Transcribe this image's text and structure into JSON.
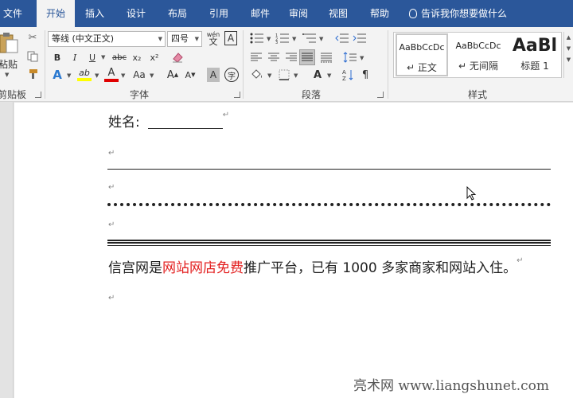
{
  "tabs": [
    {
      "label": "文件",
      "active": false
    },
    {
      "label": "开始",
      "active": true
    },
    {
      "label": "插入",
      "active": false
    },
    {
      "label": "设计",
      "active": false
    },
    {
      "label": "布局",
      "active": false
    },
    {
      "label": "引用",
      "active": false
    },
    {
      "label": "邮件",
      "active": false
    },
    {
      "label": "审阅",
      "active": false
    },
    {
      "label": "视图",
      "active": false
    },
    {
      "label": "帮助",
      "active": false
    }
  ],
  "tell_me": "告诉我你想要做什么",
  "clipboard": {
    "paste_label": "粘贴",
    "group_label": "剪贴板"
  },
  "font": {
    "name": "等线 (中文正文)",
    "size": "四号",
    "group_label": "字体",
    "phonetic_top": "wén",
    "phonetic_bottom": "文",
    "border_char": "A",
    "bold": "B",
    "italic": "I",
    "underline": "U",
    "strike": "abc",
    "subscript": "x₂",
    "superscript": "x²",
    "highlight": "ab",
    "font_color": "A",
    "change_case": "Aa",
    "grow": "A",
    "shrink": "A",
    "shade": "A",
    "enclose": "字"
  },
  "paragraph": {
    "group_label": "段落"
  },
  "styles": {
    "group_label": "样式",
    "items": [
      {
        "preview": "AaBbCcDc",
        "name": "正文",
        "selected": true
      },
      {
        "preview": "AaBbCcDc",
        "name": "无间隔",
        "selected": false
      },
      {
        "preview": "AaBl",
        "name": "标题 1",
        "selected": false
      }
    ]
  },
  "document": {
    "name_label": "姓名:",
    "paragraph_prefix": "信宫网是",
    "paragraph_red": "网站网店免费",
    "paragraph_suffix": "推广平台，已有 1000 多家商家和网站入住。"
  },
  "pilcrow": "↵",
  "watermark": "亮术网 www.liangshunet.com",
  "colors": {
    "accent": "#2b579a",
    "red_text": "#e32020",
    "highlight": "#ffff00",
    "font_color": "#e00000"
  }
}
